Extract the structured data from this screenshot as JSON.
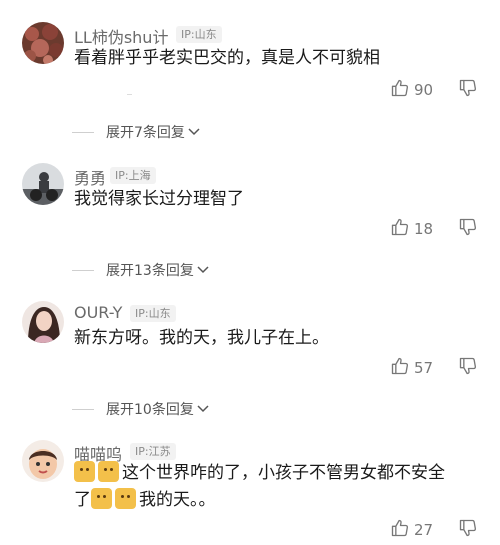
{
  "comments": [
    {
      "username": "LL柿伪shu计",
      "ip": "IP:山东",
      "text": "看着胖乎乎老实巴交的，真是人不可貌相",
      "likes": "90"
    },
    {
      "username": "勇勇",
      "ip": "IP:上海",
      "text": "我觉得家长过分理智了",
      "likes": "18"
    },
    {
      "username": "OUR-Y",
      "ip": "IP:山东",
      "text": "新东方呀。我的天，我儿子在上。",
      "likes": "57"
    },
    {
      "username": "喵喵呜",
      "ip": "IP:江苏",
      "text_line1": "这个世界咋的了，小孩子不管男女都不安全",
      "text_line2_start": "了",
      "text_line2_end": "我的天。。",
      "likes": "27"
    }
  ],
  "expands": [
    {
      "label": "展开7条回复"
    },
    {
      "label": "展开13条回复"
    },
    {
      "label": "展开10条回复"
    }
  ],
  "icons": {
    "like": "thumbs-up-icon",
    "dislike": "thumbs-down-icon",
    "chevron": "chevron-down-icon",
    "emoji": "cat-emoji-icon"
  },
  "colors": {
    "username": "#6a6a6a",
    "text": "#1a1a1a",
    "meta": "#777777"
  }
}
